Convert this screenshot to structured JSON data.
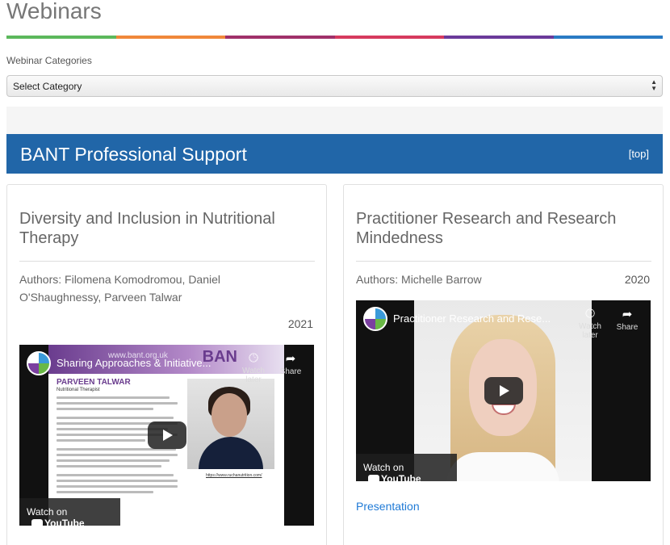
{
  "page": {
    "title": "Webinars"
  },
  "rainbow_colors": [
    "#5cb85c",
    "#f0883a",
    "#a0306a",
    "#d63a5e",
    "#6b3a9a",
    "#2a7bc4"
  ],
  "categories": {
    "label": "Webinar Categories",
    "selected": "Select Category"
  },
  "section": {
    "title": "BANT Professional Support",
    "top_link": "[top]"
  },
  "cards": [
    {
      "title": "Diversity and Inclusion in Nutritional Therapy",
      "authors": "Authors: Filomena Komodromou, Daniel O'Shaughnessy, Parveen Talwar",
      "year": "2021",
      "video": {
        "title": "Sharing Approaches & Initiative...",
        "watch_later": "Watch later",
        "share": "Share",
        "watch_on": "Watch on",
        "youtube": "YouTube",
        "slide_url": "www.bant.org.uk",
        "slide_brand": "BAN",
        "slide_name": "PARVEEN TALWAR",
        "slide_role": "Nutritional Therapist",
        "slide_link": "https://www.ruchanutrition.com/"
      }
    },
    {
      "title": "Practitioner Research and Research Mindedness",
      "authors": "Authors: Michelle Barrow",
      "year": "2020",
      "video": {
        "title": "Practitioner Research and Rese...",
        "watch_later": "Watch later",
        "share": "Share",
        "watch_on": "Watch on",
        "youtube": "YouTube"
      },
      "link": "Presentation"
    }
  ]
}
